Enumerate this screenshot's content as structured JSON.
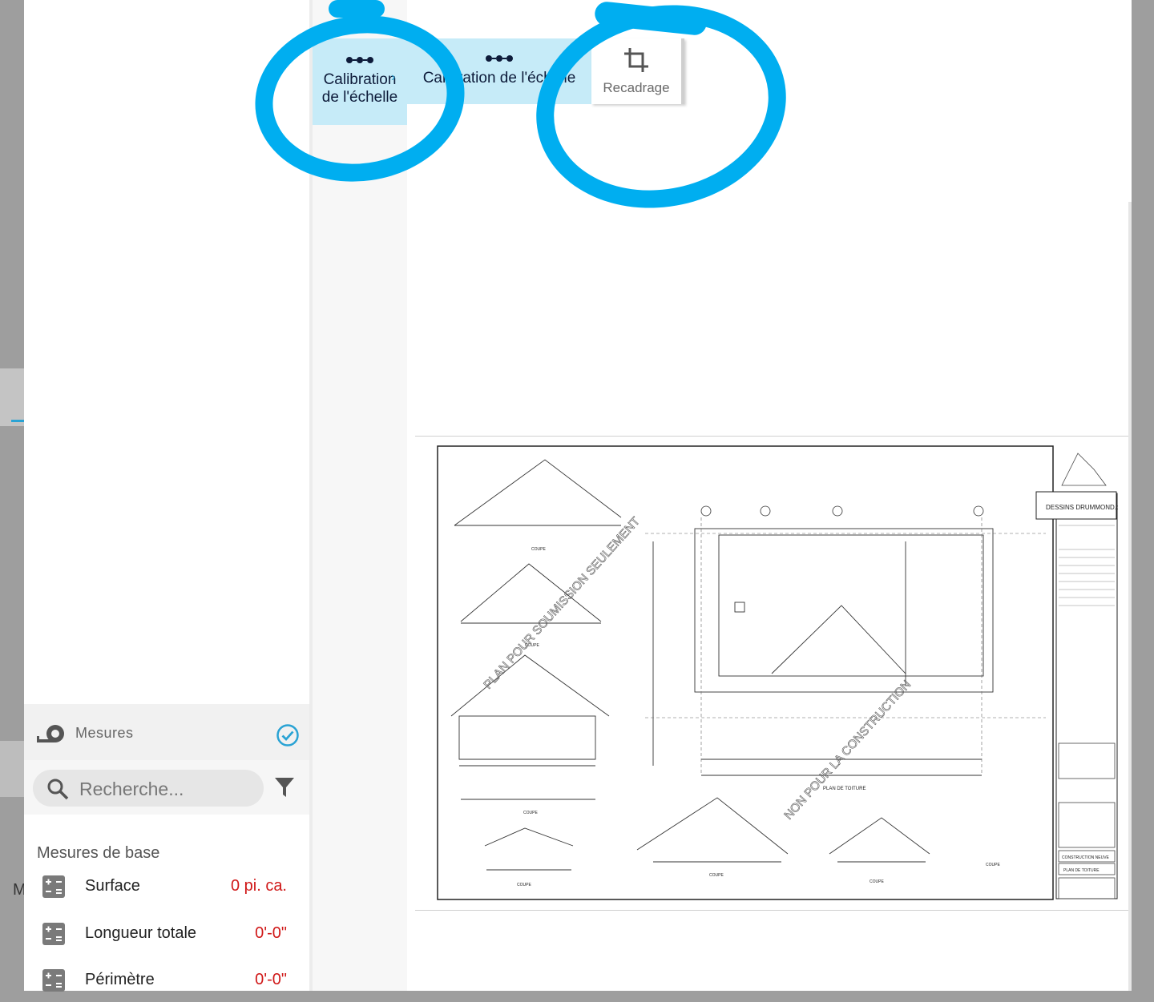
{
  "toolbar": {
    "calibration_label": "Calibration de l'échelle",
    "calibration_label_line1": "Calibration",
    "calibration_label_line2": "de l'échelle",
    "calibration_label_clipped": "Calibration de l'échelle",
    "crop_label": "Recadrage"
  },
  "measures": {
    "title": "Mesures",
    "search_placeholder": "Recherche...",
    "section_title": "Mesures de base",
    "items": [
      {
        "label": "Surface",
        "value": "0 pi. ca."
      },
      {
        "label": "Longueur totale",
        "value": "0'-0\""
      },
      {
        "label": "Périmètre",
        "value": "0'-0\""
      }
    ]
  },
  "drawing": {
    "watermark_1": "PLAN POUR SOUMISSION SEULEMENT",
    "watermark_2": "NON POUR LA CONSTRUCTION",
    "roof_plan_label": "PLAN DE TOITURE",
    "section_label": "COUPE",
    "company_name": "DESSINS DRUMMOND.com",
    "titleblock_project": "CONSTRUCTION NEUVE",
    "titleblock_sheet": "PLAN DE TOITURE"
  },
  "background": {
    "letter": "M"
  },
  "colors": {
    "accent": "#2aa3d4",
    "marker": "#00aef0",
    "value_red": "#d01818",
    "selected_tool": "#c6ebf8"
  },
  "icons": {
    "calibration": "calibration-icon",
    "crop": "crop-icon",
    "tape": "tape-measure-icon",
    "check": "check-circle-icon",
    "search": "search-icon",
    "filter": "filter-icon",
    "calculator": "calculator-icon"
  }
}
